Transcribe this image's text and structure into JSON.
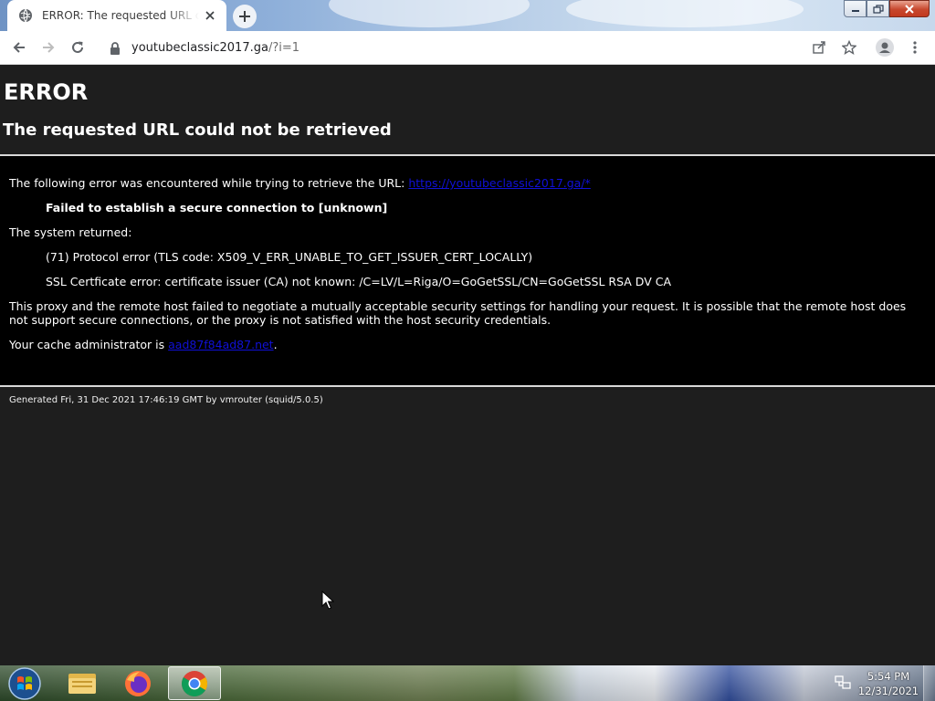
{
  "browser": {
    "tab": {
      "title": "ERROR: The requested URL could not be retrieved"
    },
    "address_bar": {
      "domain": "youtubeclassic2017.ga",
      "path": "/?i=1"
    }
  },
  "page": {
    "heading": "ERROR",
    "subheading": "The requested URL could not be retrieved",
    "intro_text": "The following error was encountered while trying to retrieve the URL:",
    "intro_link": "https://youtubeclassic2017.ga/*",
    "error_message": "Failed to establish a secure connection to [unknown]",
    "system_returned_label": "The system returned:",
    "protocol_error": "(71) Protocol error (TLS code: X509_V_ERR_UNABLE_TO_GET_ISSUER_CERT_LOCALLY)",
    "ssl_error": "SSL Certficate error: certificate issuer (CA) not known: /C=LV/L=Riga/O=GoGetSSL/CN=GoGetSSL RSA DV CA",
    "explanation": "This proxy and the remote host failed to negotiate a mutually acceptable security settings for handling your request. It is possible that the remote host does not support secure connections, or the proxy is not satisfied with the host security credentials.",
    "admin_prefix": "Your cache administrator is ",
    "admin_link": "aad87f84ad87.net",
    "admin_suffix": ".",
    "footer": "Generated Fri, 31 Dec 2021 17:46:19 GMT by vmrouter (squid/5.0.5)"
  },
  "taskbar": {
    "items": [
      "windows-start",
      "windows-explorer",
      "firefox",
      "chrome"
    ],
    "clock_time": "5:54 PM",
    "clock_date": "12/31/2021"
  },
  "colors": {
    "page_background": "#1e1e1e",
    "content_background": "#000000",
    "link": "#1010d8"
  }
}
